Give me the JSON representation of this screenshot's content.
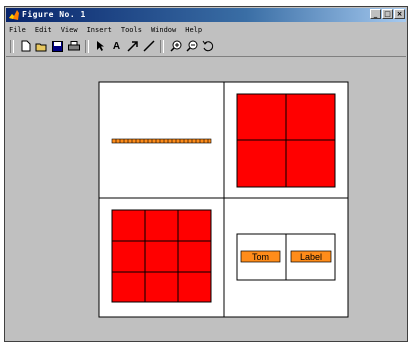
{
  "window": {
    "title": "Figure No. 1",
    "controls": [
      "_",
      "□",
      "×"
    ]
  },
  "menu": {
    "items": [
      "File",
      "Edit",
      "View",
      "Insert",
      "Tools",
      "Window",
      "Help"
    ]
  },
  "toolbar": {
    "icons": [
      "new-icon",
      "open-icon",
      "save-icon",
      "print-icon",
      "select-arrow-icon",
      "text-icon",
      "arrow-icon",
      "line-icon",
      "zoom-in-icon",
      "zoom-out-icon",
      "rotate-icon"
    ]
  },
  "figure": {
    "labels": {
      "left": "Tom",
      "right": "Label"
    },
    "colors": {
      "red": "#ff0000",
      "orange": "#ff8c1a",
      "white": "#ffffff",
      "gray": "#c0c0c0"
    }
  }
}
